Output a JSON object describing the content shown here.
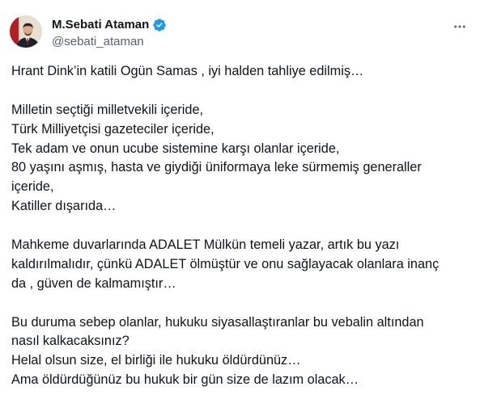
{
  "author": {
    "display_name": "M.Sebati Ataman",
    "handle": "@sebati_ataman",
    "verified": true,
    "verified_color": "#1d9bf0"
  },
  "icons": {
    "verified": "verified-badge-icon",
    "more": "more-options-icon"
  },
  "tweet": {
    "paragraphs": [
      {
        "lines": [
          "Hrant Dink’in katili Ogün Samas , iyi halden tahliye edilmiş…"
        ]
      },
      {
        "lines": [
          "Milletin seçtiği milletvekili içeride,",
          "Türk Milliyetçisi gazeteciler içeride,",
          "Tek adam ve onun ucube sistemine karşı olanlar içeride,",
          "80 yaşını aşmış, hasta ve giydiği üniformaya leke sürmemiş generaller",
          "içeride,",
          "Katiller dışarıda…"
        ]
      },
      {
        "lines": [
          "Mahkeme duvarlarında ADALET Mülkün temeli yazar, artık bu yazı",
          "kaldırılmalıdır, çünkü ADALET ölmüştür ve onu sağlayacak olanlara inanç",
          "da , güven de kalmamıştır…"
        ]
      },
      {
        "lines": [
          "Bu duruma sebep olanlar, hukuku siyasallaştıranlar bu vebalin altından",
          "nasıl kalkacaksınız?",
          "Helal olsun size, el birliği ile hukuku öldürdünüz…",
          "Ama öldürdüğünüz bu hukuk bir gün size de lazım olacak…"
        ]
      }
    ]
  }
}
